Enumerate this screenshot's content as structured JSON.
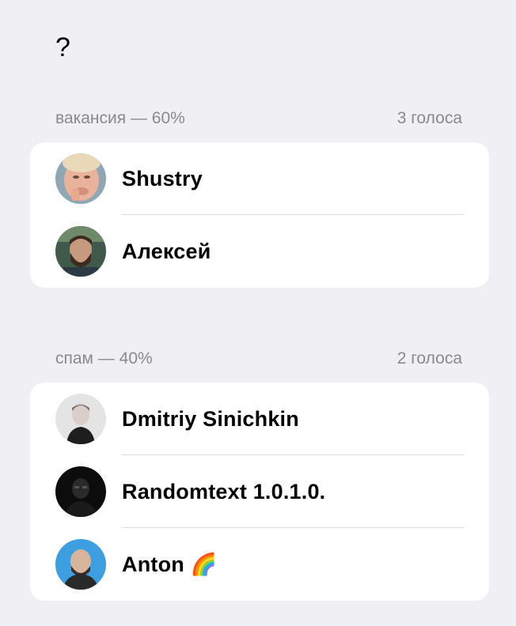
{
  "poll": {
    "question": "?"
  },
  "options": [
    {
      "label": "вакансия — 60%",
      "votes": "3 голоса",
      "voters": [
        {
          "name": "Shustry",
          "avatar": "avatar-photo"
        },
        {
          "name": "Алексей",
          "avatar": "avatar-photo"
        }
      ]
    },
    {
      "label": "спам — 40%",
      "votes": "2 голоса",
      "voters": [
        {
          "name": "Dmitriy Sinichkin",
          "avatar": "avatar-photo"
        },
        {
          "name": "Randomtext 1.0.1.0.",
          "avatar": "avatar-photo"
        },
        {
          "name": "Anton 🌈",
          "avatar": "avatar-photo"
        }
      ]
    }
  ],
  "colors": {
    "background": "#efeff4",
    "card": "#ffffff",
    "secondary_text": "#8a8a8e",
    "divider": "#dcdce0"
  }
}
